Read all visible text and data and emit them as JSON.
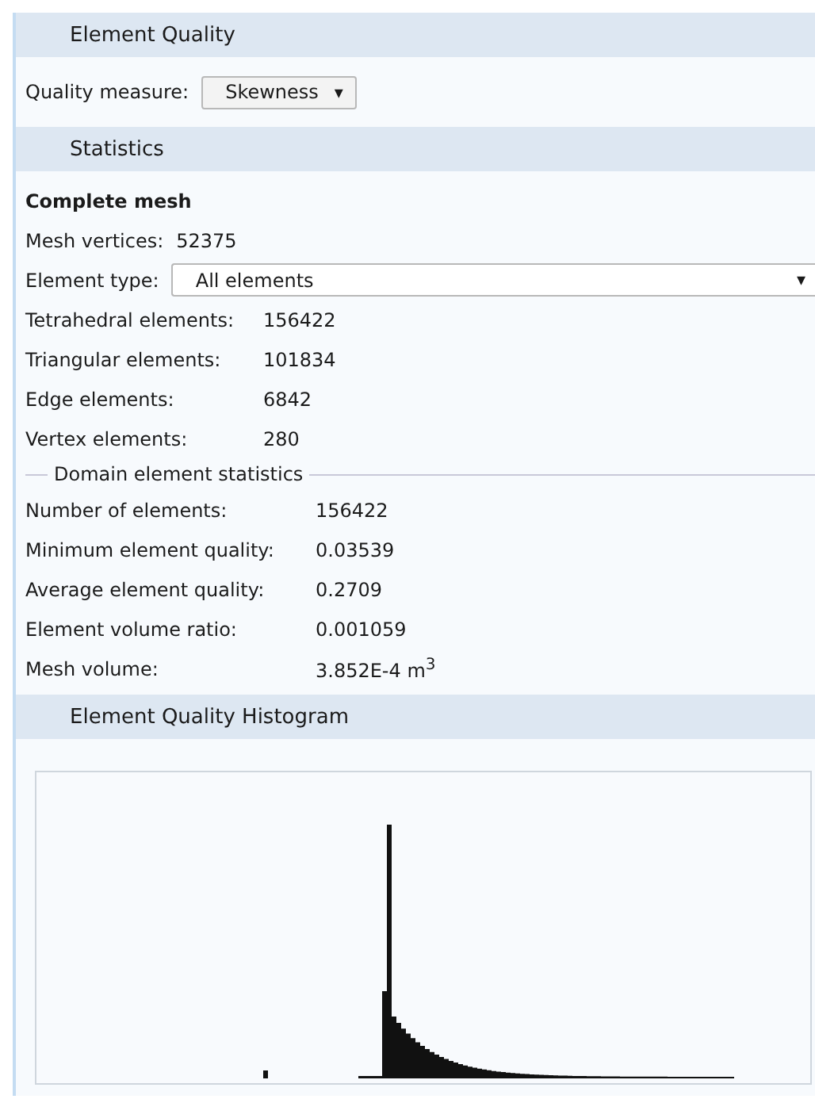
{
  "element_quality": {
    "title": "Element Quality",
    "quality_measure": {
      "label": "Quality measure:",
      "value": "Skewness",
      "caret": "▾"
    }
  },
  "statistics": {
    "title": "Statistics",
    "heading": "Complete mesh",
    "mesh_vertices": {
      "label": "Mesh vertices:",
      "value": "52375"
    },
    "element_type": {
      "label": "Element type:",
      "value": "All elements",
      "caret": "▾"
    },
    "mesh_stats": [
      {
        "label": "Tetrahedral elements:",
        "value": "156422"
      },
      {
        "label": "Triangular elements:",
        "value": "101834"
      },
      {
        "label": "Edge elements:",
        "value": "6842"
      },
      {
        "label": "Vertex elements:",
        "value": "280"
      }
    ],
    "domain_group": {
      "title": "Domain element statistics",
      "rows": [
        {
          "label": "Number of elements:",
          "value": "156422"
        },
        {
          "label": "Minimum element quality:",
          "value": "0.03539"
        },
        {
          "label": "Average element quality:",
          "value": "0.2709"
        },
        {
          "label": "Element volume ratio:",
          "value": "0.001059"
        },
        {
          "label": "Mesh volume:",
          "value": "3.852E-4 m$^{3}$"
        }
      ]
    }
  },
  "histogram": {
    "title": "Element Quality Histogram"
  }
}
